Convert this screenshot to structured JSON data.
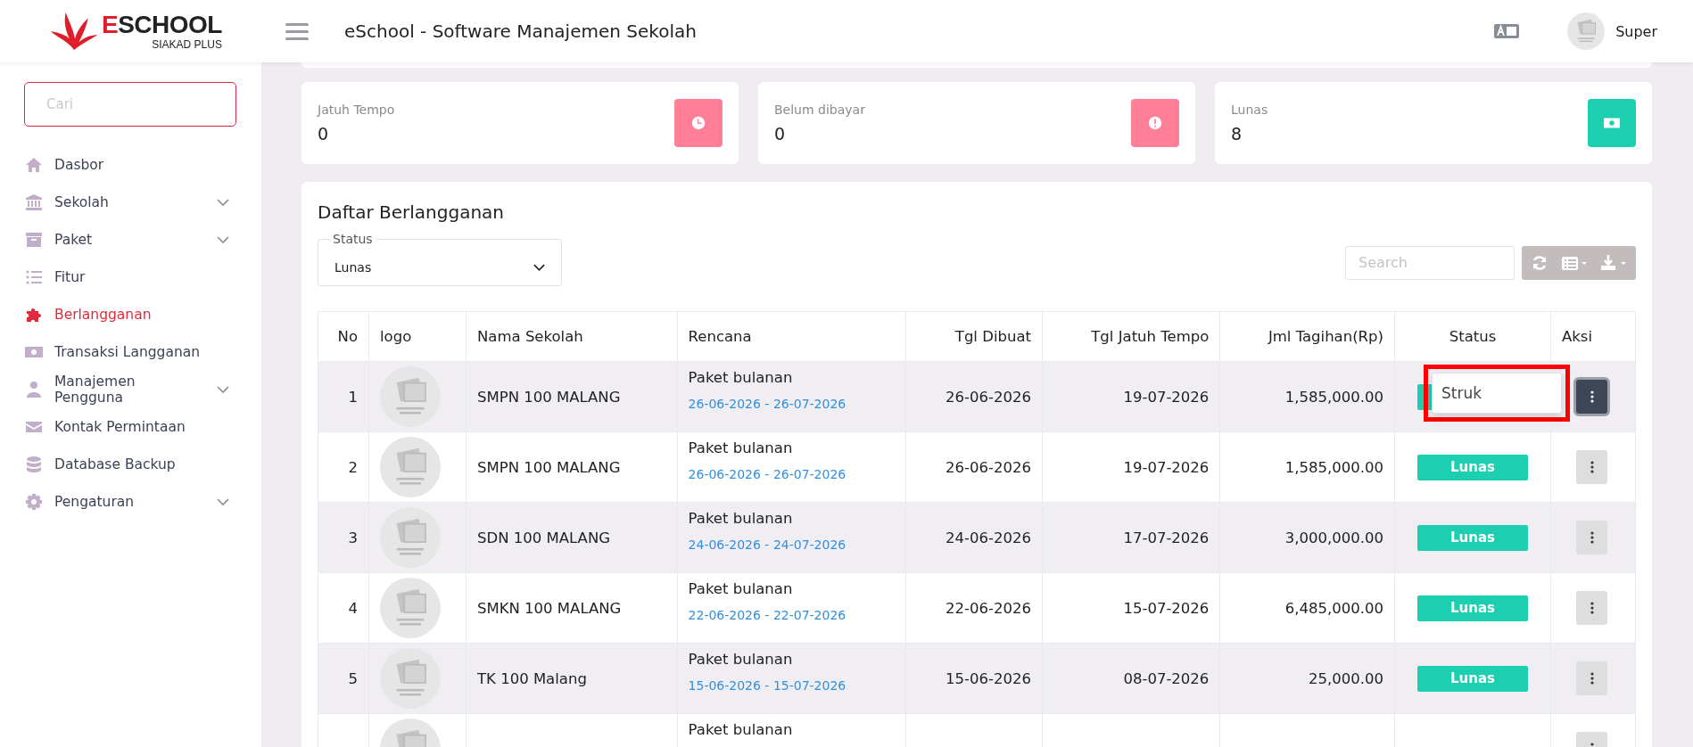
{
  "logo": {
    "title": "ESCHOOL",
    "subtitle": "SIAKAD PLUS"
  },
  "header": {
    "title": "eSchool - Software Manajemen Sekolah",
    "user": "Super"
  },
  "sidebar": {
    "search": {
      "placeholder": "Cari"
    },
    "items": [
      {
        "label": "Dasbor",
        "kind": "home",
        "selected": false,
        "expandable": false
      },
      {
        "label": "Sekolah",
        "kind": "bank",
        "selected": false,
        "expandable": true
      },
      {
        "label": "Paket",
        "kind": "archive",
        "selected": false,
        "expandable": true
      },
      {
        "label": "Fitur",
        "kind": "list",
        "selected": false,
        "expandable": false
      },
      {
        "label": "Berlangganan",
        "kind": "puzzle",
        "selected": true,
        "expandable": false
      },
      {
        "label": "Transaksi Langganan",
        "kind": "money",
        "selected": false,
        "expandable": false
      },
      {
        "label": "Manajemen Pengguna",
        "kind": "user",
        "selected": false,
        "expandable": true
      },
      {
        "label": "Kontak Permintaan",
        "kind": "mail",
        "selected": false,
        "expandable": false
      },
      {
        "label": "Database Backup",
        "kind": "database",
        "selected": false,
        "expandable": false
      },
      {
        "label": "Pengaturan",
        "kind": "gear",
        "selected": false,
        "expandable": true
      }
    ]
  },
  "stats": [
    {
      "label": "Jatuh Tempo",
      "value": "0",
      "kind": "clock",
      "color": "#ff7f98"
    },
    {
      "label": "Belum dibayar",
      "value": "0",
      "kind": "alert",
      "color": "#ff7f98"
    },
    {
      "label": "Lunas",
      "value": "8",
      "kind": "money",
      "color": "#1ccfb0"
    }
  ],
  "subscriptions": {
    "title": "Daftar Berlangganan",
    "filter": {
      "label": "Status",
      "value": "Lunas"
    },
    "search": {
      "placeholder": "Search"
    },
    "columns": [
      "No",
      "logo",
      "Nama Sekolah",
      "Rencana",
      "Tgl Dibuat",
      "Tgl Jatuh Tempo",
      "Jml Tagihan(Rp)",
      "Status",
      "Aksi"
    ],
    "rows": [
      {
        "no": "1",
        "school": "SMPN 100 MALANG",
        "plan": "Paket bulanan",
        "period": "26-06-2026 - 26-07-2026",
        "created": "26-06-2026",
        "due": "19-07-2026",
        "amount": "1,585,000.00",
        "menu_open": true,
        "menu_items": [
          "Struk"
        ]
      },
      {
        "no": "2",
        "school": "SMPN 100 MALANG",
        "plan": "Paket bulanan",
        "period": "26-06-2026 - 26-07-2026",
        "created": "26-06-2026",
        "due": "19-07-2026",
        "amount": "1,585,000.00",
        "status": "Lunas",
        "menu_open": false
      },
      {
        "no": "3",
        "school": "SDN 100 MALANG",
        "plan": "Paket bulanan",
        "period": "24-06-2026 - 24-07-2026",
        "created": "24-06-2026",
        "due": "17-07-2026",
        "amount": "3,000,000.00",
        "status": "Lunas",
        "menu_open": false
      },
      {
        "no": "4",
        "school": "SMKN 100 MALANG",
        "plan": "Paket bulanan",
        "period": "22-06-2026 - 22-07-2026",
        "created": "22-06-2026",
        "due": "15-07-2026",
        "amount": "6,485,000.00",
        "status": "Lunas",
        "menu_open": false
      },
      {
        "no": "5",
        "school": "TK 100 Malang",
        "plan": "Paket bulanan",
        "period": "15-06-2026 - 15-07-2026",
        "created": "15-06-2026",
        "due": "08-07-2026",
        "amount": "25,000.00",
        "status": "Lunas",
        "menu_open": false
      },
      {
        "plan": "Paket bulanan",
        "menu_open": false
      }
    ]
  }
}
